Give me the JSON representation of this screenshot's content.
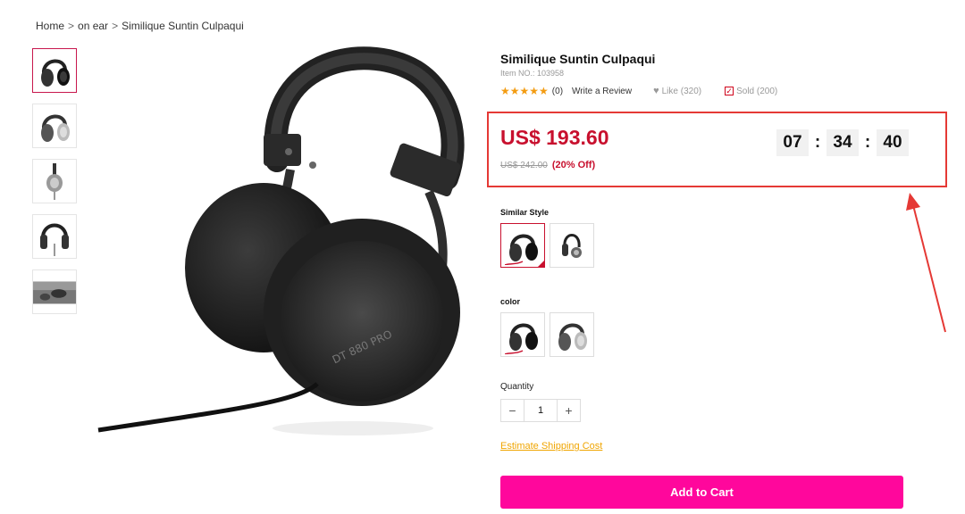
{
  "breadcrumb": {
    "home": "Home",
    "category": "on ear",
    "current": "Similique Suntin Culpaqui",
    "separator": ">"
  },
  "product": {
    "title": "Similique Suntin Culpaqui",
    "item_no": "Item NO.: 103958",
    "rating_count": "(0)",
    "write_review": "Write a Review",
    "like": "Like (320)",
    "sold": "Sold (200)",
    "price": "US$ 193.60",
    "old_price": "US$ 242.00",
    "discount": "(20% Off)",
    "rating_stars": 5
  },
  "countdown": {
    "hours": "07",
    "minutes": "34",
    "seconds": "40",
    "colon": ":"
  },
  "similar_style": {
    "label": "Similar Style"
  },
  "color": {
    "label": "color"
  },
  "quantity": {
    "label": "Quantity",
    "value": "1",
    "minus": "−",
    "plus": "+"
  },
  "shipping": {
    "link": "Estimate Shipping Cost"
  },
  "cart": {
    "button": "Add to Cart"
  },
  "colors": {
    "price_red": "#c8102e",
    "highlight_border": "#e53935",
    "cart_pink": "#ff079c",
    "star_orange": "#f39c12",
    "link_orange": "#f0a500"
  }
}
